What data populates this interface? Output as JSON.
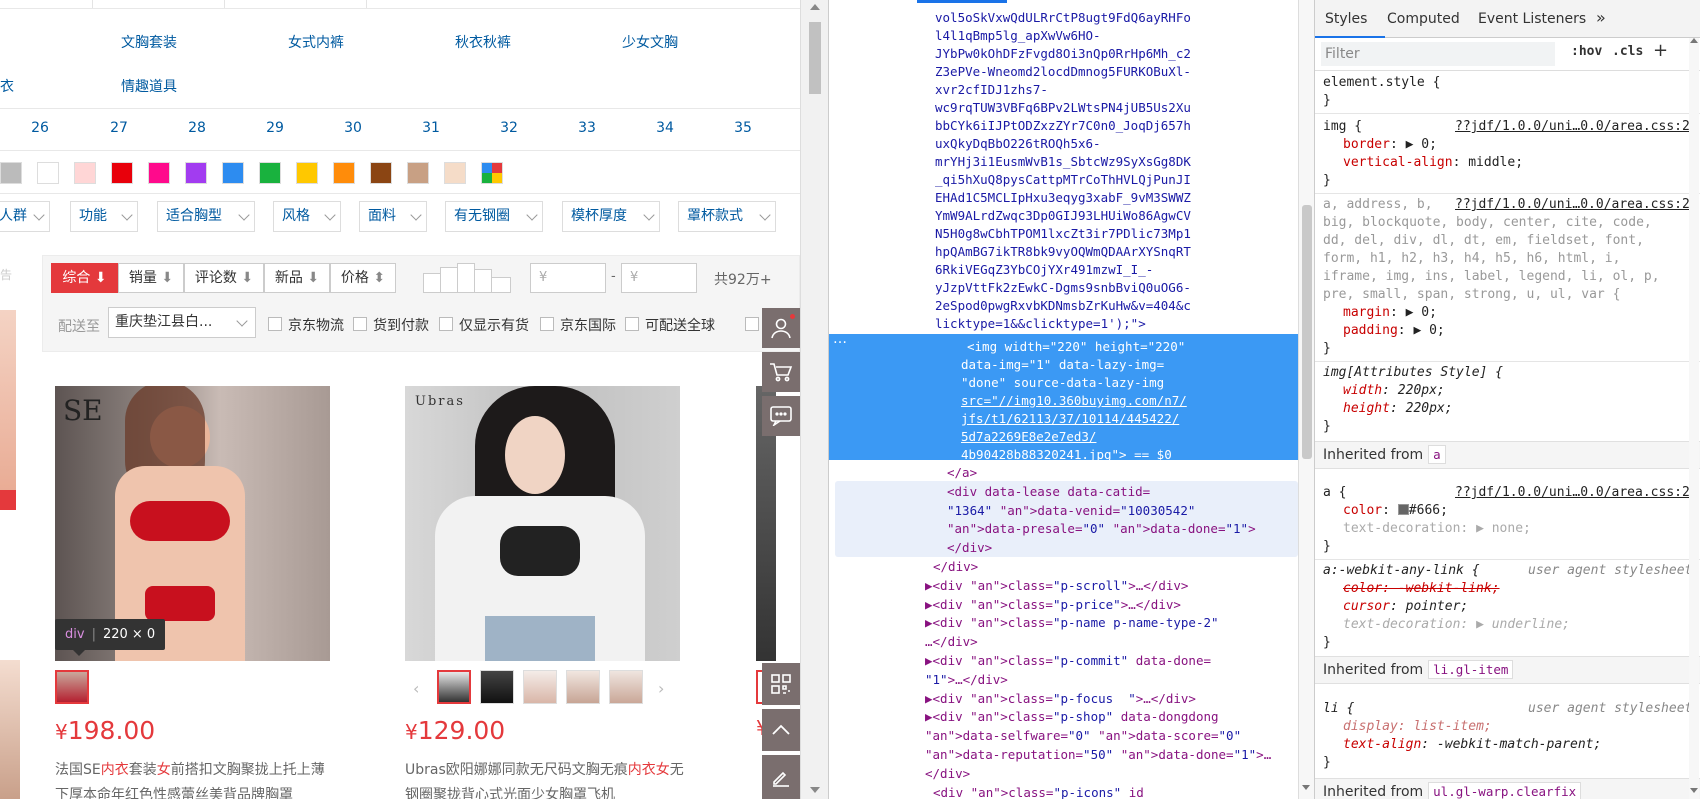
{
  "page": {
    "categories_row1": [
      "文胸套装",
      "女式内裤",
      "秋衣秋裤",
      "少女文胸"
    ],
    "categories_row2": [
      "衣",
      "情趣道具"
    ],
    "sizes": [
      "26",
      "27",
      "28",
      "29",
      "30",
      "31",
      "32",
      "33",
      "34",
      "35"
    ],
    "swatch_colors": [
      "#bbbbbb",
      "#ffffff",
      "#ffd6d6",
      "#e8000b",
      "#ff0a8c",
      "#a23cf0",
      "#2d8cf0",
      "#19b23e",
      "#ffc800",
      "#ff8c0a",
      "#8b4513",
      "#c8a084",
      "#f5dcc8",
      "multi"
    ],
    "dropdowns": [
      "人群",
      "功能",
      "适合胸型",
      "风格",
      "面料",
      "有无钢圈",
      "模杯厚度",
      "罩杯款式"
    ],
    "side_text": "告",
    "sort": {
      "comprehensive": "综合",
      "sales": "销量",
      "reviews": "评论数",
      "new": "新品",
      "price": "价格"
    },
    "price_range": {
      "min_placeholder": "¥",
      "dash": "-",
      "max_placeholder": "¥"
    },
    "total": "共92万+",
    "ship_to_label": "配送至",
    "ship_to_value": "重庆垫江县白...",
    "filters": [
      "京东物流",
      "货到付款",
      "仅显示有货",
      "京东国际",
      "可配送全球"
    ],
    "products": [
      {
        "brand": "SE",
        "price_symbol": "¥",
        "price": "198.00",
        "name_html": "法国SE<em>内衣</em>套装<em>女</em>前搭扣文胸聚拢上托上薄下厚本命年红色性感蕾丝美背品牌胸罩"
      },
      {
        "brand": "Ubras",
        "price_symbol": "¥",
        "price": "129.00",
        "name_html": "Ubras欧阳娜娜同款无尺码文胸无痕<em>内衣</em><em>女</em>无钢圈聚拢背心式光面少女胸罩飞机"
      }
    ],
    "tooltip": {
      "tag": "div",
      "size": "220 × 0"
    }
  },
  "devtools": {
    "elements_lines": [
      "vol5oSkVxwQdULRrCtP8ugt9FdQ6ayRHFo",
      "l4l1qBmp5lg_apXwVw6HO-",
      "JYbPw0kOhDFzFvgd8Oi3nQp0RrHp6Mh_c2",
      "Z3ePVe-Wneomd2locdDmnog5FURKOBuXl-",
      "xvr2cfIDJ1zhs7-",
      "wc9rqTUW3VBFq6BPv2LWtsPN4jUB5Us2Xu",
      "bbCYk6iIJPtODZxzZYr7C0n0_JoqDj657h",
      "uxQkyDqBbO226tROQh5x6-",
      "mrYHj3i1EusmWvB1s_SbtcWz9SyXsGg8DK",
      "_qi5hXuQ8pysCattpMTrCoThHVLQjPunJI",
      "EHAd1C5MCLIpHxu3eqyg3xabF_9vM3SWWZ",
      "YmW9ALrdZwqc3Dp0GIJ93LHUiWo86AgwCV",
      "N5H0g8wCbhTPOM1lxcZt3ir7PDlic73Mp1",
      "hpQAmBG7ikTR8bk9vyOQWmQDAArXYSnqRT",
      "6RkiVEGqZ3YbCOjYXr491mzwI_I_-",
      "yJzpVttFk2zEwkC-Dgms9snbBviQ0uOG6-",
      "2eSpod0pwgRxvbKDNmsbZrKuHw&v=404&c",
      "licktype=1&&clicktype=1');\">"
    ],
    "selected_lines": [
      "<img width=\"220\" height=\"220\"",
      "data-img=\"1\" data-lazy-img=",
      "\"done\" source-data-lazy-img",
      "src=\"//img10.360buyimg.com/n7/",
      "jfs/t1/62113/37/10114/445422/",
      "5d7a2269E8e2e7ed3/",
      "4b90428b88320241.jpg\"> == $0"
    ],
    "after_lines": [
      "</a>",
      "<div data-lease data-catid=",
      "\"1364\" data-venid=\"10030542\"",
      "data-presale=\"0\" data-done=\"1\">",
      "</div>",
      "</div>",
      "▶<div class=\"p-scroll\">…</div>",
      "▶<div class=\"p-price\">…</div>",
      "▶<div class=\"p-name p-name-type-2\"",
      "…</div>",
      "▶<div class=\"p-commit\" data-done=",
      "\"1\">…</div>",
      "▶<div class=\"p-focus  \">…</div>",
      "▶<div class=\"p-shop\" data-dongdong",
      "data-selfware=\"0\" data-score=\"0\"",
      "data-reputation=\"50\" data-done=\"1\">…",
      "</div>",
      "<div class=\"p-icons\" id"
    ],
    "tabs": [
      "Styles",
      "Computed",
      "Event Listeners",
      "»"
    ],
    "filter_placeholder": "Filter",
    "hov": ":hov",
    "cls": ".cls",
    "plus": "+",
    "source_link": "??jdf/1.0.0/uni…0.0/area.css:2",
    "user_agent": "user agent stylesheet",
    "inherited_from_label": "Inherited from",
    "inherited_a": "a",
    "inherited_li": "li.gl-item",
    "inherited_ul": "ul.gl-warp.clearfix",
    "rules": {
      "element_style": "element.style {",
      "img_sel": "img {",
      "img_border": "border",
      "img_border_v": "▶ 0;",
      "img_va": "vertical-align",
      "img_va_v": ": middle;",
      "reset_sel_1": "a, address, b,",
      "reset_sel_2": "big, blockquote, body, center, cite, code,",
      "reset_sel_3": "dd, del, div, dl, dt, em, fieldset, font,",
      "reset_sel_4": "form, h1, h2, h3, h4, h5, h6, html, i,",
      "reset_sel_5": "iframe, img, ins, label, legend, li, ol, p,",
      "reset_sel_6": "pre, small, span, strong, u, ul, var {",
      "margin": "margin",
      "padding": "padding",
      "zero": "▶ 0;",
      "attr_sel": "img[Attributes Style] {",
      "width": "width",
      "width_v": ": 220px;",
      "height": "height",
      "height_v": ": 220px;",
      "a_sel": "a {",
      "color": "color",
      "color_v": "#666;",
      "text_decoration": "text-decoration",
      "none_v": "▶ none;",
      "wal_sel": "a:-webkit-any-link {",
      "wal_color": "color: -webkit-link;",
      "cursor": "cursor",
      "cursor_v": ": pointer;",
      "underline_v": "▶ underline;",
      "li_sel": "li {",
      "display": "display",
      "display_v": ": list-item;",
      "text_align": "text-align",
      "text_align_v": ": -webkit-match-parent;",
      "close": "}"
    }
  }
}
